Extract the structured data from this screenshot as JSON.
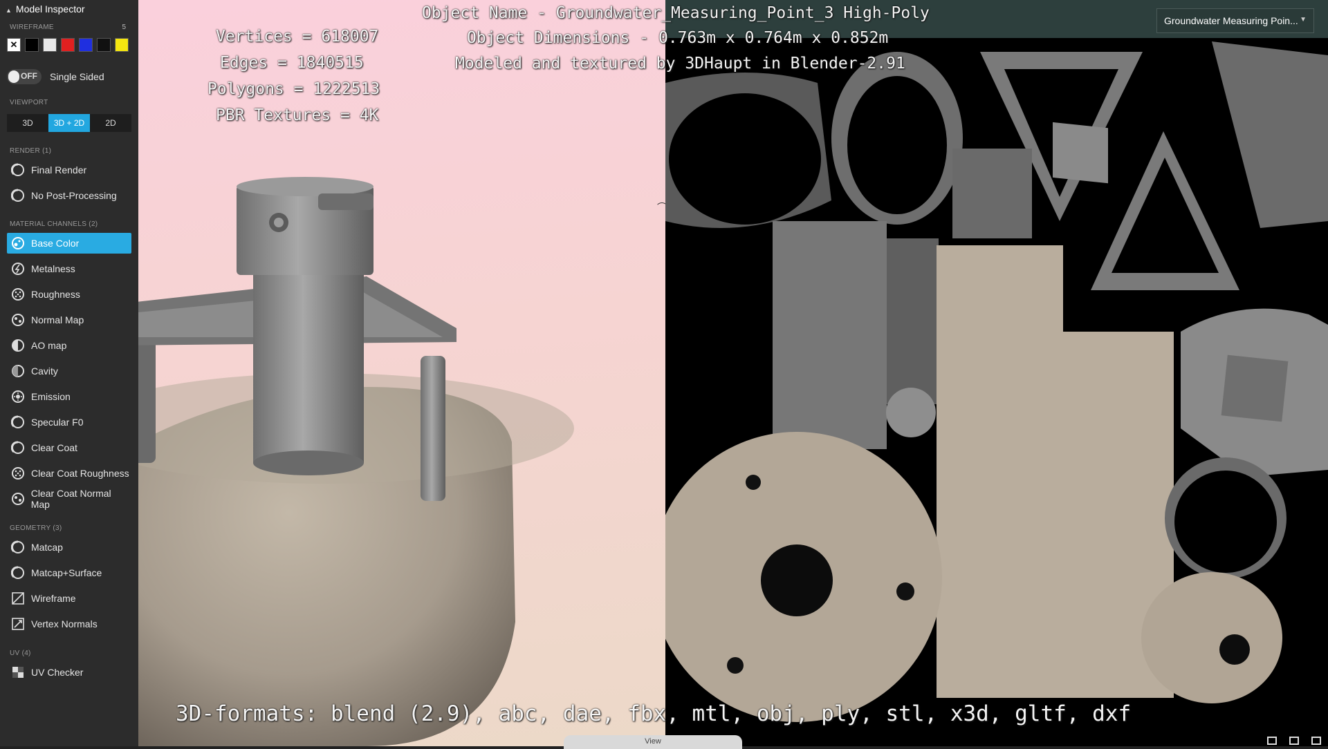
{
  "sidebar": {
    "title": "Model Inspector",
    "wireframe": {
      "label": "WIREFRAME",
      "count": "5",
      "colors": [
        "#ffffff",
        "#000000",
        "#e8e8e8",
        "#e02020",
        "#1f2fe0",
        "#111111",
        "#f4e610"
      ]
    },
    "single_sided": {
      "toggle": "OFF",
      "label": "Single Sided"
    },
    "viewport": {
      "label": "VIEWPORT",
      "buttons": [
        "3D",
        "3D + 2D",
        "2D"
      ]
    },
    "render": {
      "label": "RENDER (1)",
      "items": [
        "Final Render",
        "No Post-Processing"
      ]
    },
    "material": {
      "label": "MATERIAL CHANNELS (2)",
      "items": [
        "Base Color",
        "Metalness",
        "Roughness",
        "Normal Map",
        "AO map",
        "Cavity",
        "Emission",
        "Specular F0",
        "Clear Coat",
        "Clear Coat Roughness",
        "Clear Coat Normal Map"
      ]
    },
    "geometry": {
      "label": "GEOMETRY (3)",
      "items": [
        "Matcap",
        "Matcap+Surface",
        "Wireframe",
        "Vertex Normals"
      ]
    },
    "uv": {
      "label": "UV (4)",
      "items": [
        "UV Checker"
      ]
    }
  },
  "overlay": {
    "stats": [
      "Vertices = 618007",
      "Edges = 1840515",
      "Polygons = 1222513",
      "PBR Textures = 4K"
    ],
    "name": "Object Name - Groundwater_Measuring_Point_3 High-Poly",
    "dims": "Object Dimensions - 0.763m x 0.764m x 0.852m",
    "credit": "Modeled and textured by 3DHaupt in Blender-2.91",
    "formats": "3D-formats: blend (2.9), abc, dae, fbx, mtl, obj, ply, stl, x3d, gltf, dxf"
  },
  "model_select": "Groundwater Measuring Poin...",
  "bottom_tab": "View",
  "colors": {
    "accent": "#29abe2",
    "sidebar_bg": "#2c2c2c",
    "topbar_bg": "#2d3f3d"
  }
}
